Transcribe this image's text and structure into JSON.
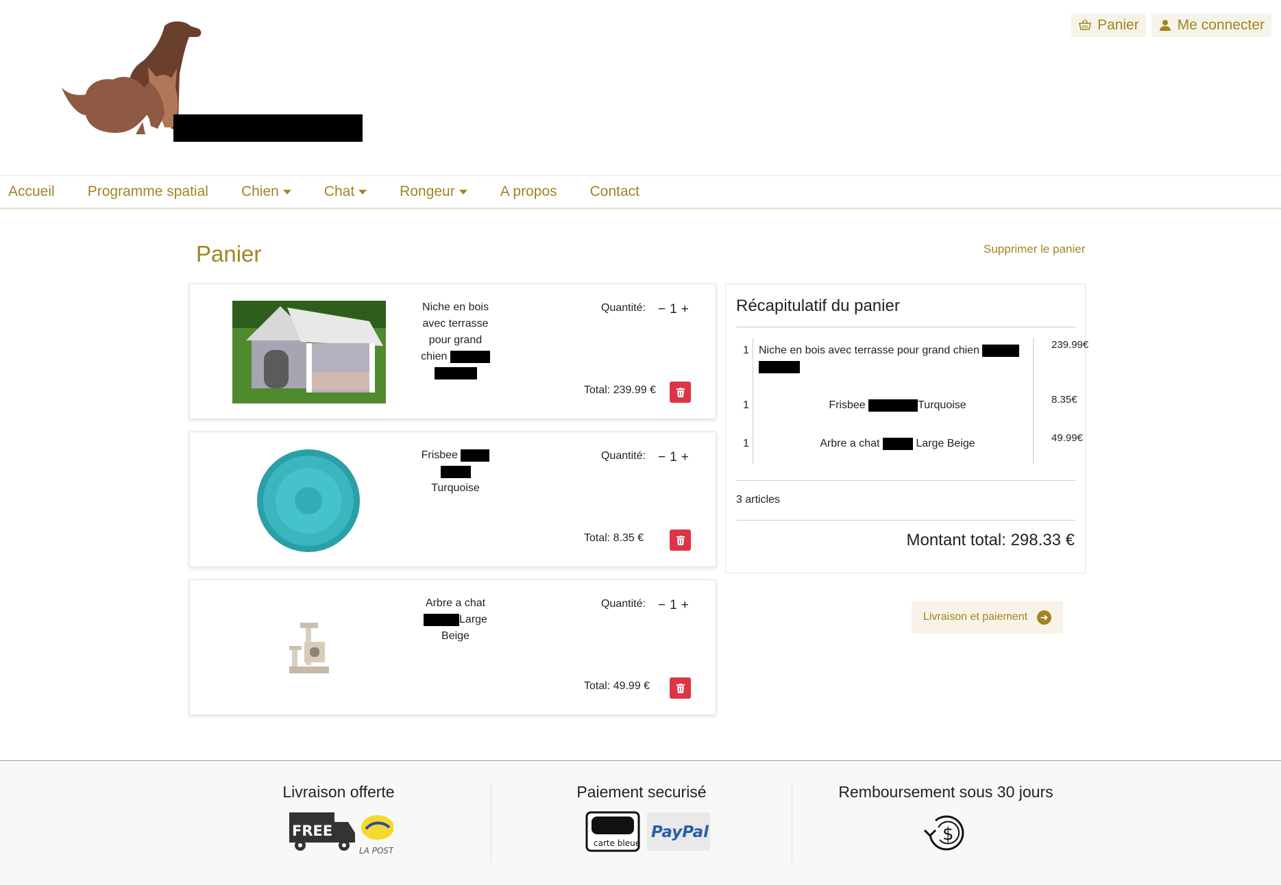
{
  "header": {
    "cart_label": "Panier",
    "login_label": "Me connecter"
  },
  "nav": {
    "items": [
      {
        "label": "Accueil",
        "dropdown": false
      },
      {
        "label": "Programme spatial",
        "dropdown": false
      },
      {
        "label": "Chien",
        "dropdown": true
      },
      {
        "label": "Chat",
        "dropdown": true
      },
      {
        "label": "Rongeur",
        "dropdown": true
      },
      {
        "label": "A propos",
        "dropdown": false
      },
      {
        "label": "Contact",
        "dropdown": false
      }
    ]
  },
  "cart": {
    "title": "Panier",
    "clear_label": "Supprimer le panier",
    "qty_label": "Quantité:",
    "items": [
      {
        "name_parts": [
          "Niche en bois",
          "avec terrasse",
          "pour grand",
          "chien"
        ],
        "quantity": "1",
        "total": "Total: 239.99 €"
      },
      {
        "name_parts": [
          "Frisbee",
          "Turquoise"
        ],
        "quantity": "1",
        "total": "Total: 8.35 €"
      },
      {
        "name_parts": [
          "Arbre a chat",
          "Large",
          "Beige"
        ],
        "quantity": "1",
        "total": "Total: 49.99 €"
      }
    ]
  },
  "summary": {
    "title": "Récapitulatif du panier",
    "rows": [
      {
        "qty": "1",
        "name_a": "Niche en bois avec terrasse pour grand chien",
        "name_b": "",
        "price": "239.99€"
      },
      {
        "qty": "1",
        "name_a": "Frisbee",
        "name_b": "Turquoise",
        "price": "8.35€"
      },
      {
        "qty": "1",
        "name_a": "Arbre a chat",
        "name_b": "Large Beige",
        "price": "49.99€"
      }
    ],
    "count": "3 articles",
    "total": "Montant total: 298.33 €"
  },
  "checkout": {
    "label": "Livraison et paiement"
  },
  "footer": {
    "delivery_title": "Livraison offerte",
    "payment_title": "Paiement securisé",
    "refund_title": "Remboursement sous 30 jours",
    "free_badge": "FREE",
    "laposte_label": "LA POSTE",
    "cb_label": "carte bleue",
    "paypal_label": "PayPal"
  },
  "colors": {
    "accent": "#a08521",
    "danger": "#dc3545",
    "dog": "#6b3f2e",
    "cat": "#b0775a"
  }
}
